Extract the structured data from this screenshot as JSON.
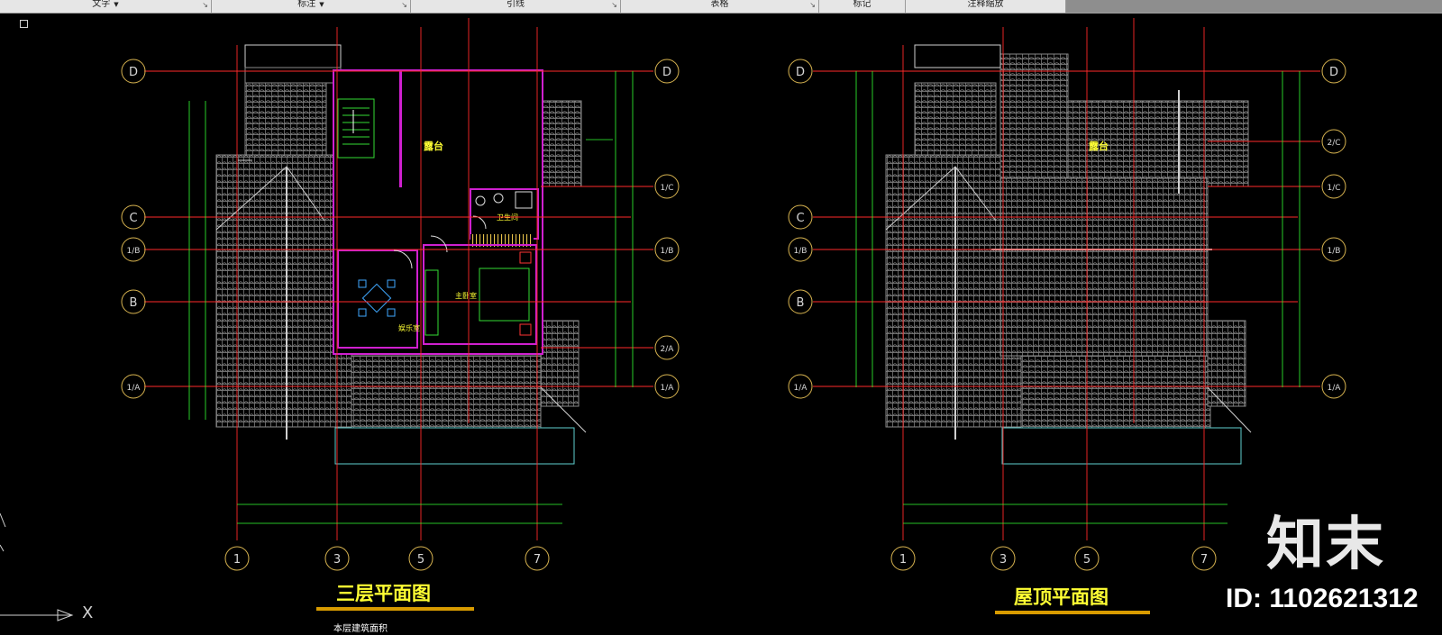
{
  "ribbon": {
    "panels": [
      {
        "label": "文字",
        "dropdown": true
      },
      {
        "label": "标注",
        "dropdown": true
      },
      {
        "label": "引线",
        "dropdown": false
      },
      {
        "label": "表格",
        "dropdown": false
      },
      {
        "label": "标记",
        "dropdown": false
      },
      {
        "label": "注释缩放",
        "dropdown": false
      }
    ]
  },
  "drawing": {
    "left_plan": {
      "title": "三层平面图",
      "note": "本层建筑面积",
      "room_labels": {
        "terrace": "露台",
        "bathroom": "卫生间",
        "master_bedroom": "主卧室",
        "entertainment": "娱乐室"
      },
      "grid_left": [
        "D",
        "C",
        "1/B",
        "B",
        "1/A"
      ],
      "grid_right": [
        "D",
        "1/C",
        "1/B",
        "2/A",
        "1/A"
      ],
      "grid_bottom": [
        "1",
        "3",
        "5",
        "7"
      ]
    },
    "right_plan": {
      "title": "屋顶平面图",
      "room_labels": {
        "terrace": "露台"
      },
      "grid_left": [
        "D",
        "C",
        "1/B",
        "B",
        "1/A"
      ],
      "grid_right": [
        "D",
        "2/C",
        "1/C",
        "1/B",
        "1/A"
      ],
      "grid_bottom": [
        "1",
        "3",
        "5",
        "7"
      ]
    }
  },
  "ucs": {
    "x_label": "X"
  },
  "watermark": {
    "logo": "知末",
    "id": "ID: 1102621312"
  },
  "colors": {
    "background": "#000000",
    "grid_axis_red": "#ff2a2a",
    "grid_axis_green": "#33ff33",
    "bubble_gold": "#d8b450",
    "roof_gray": "#8a8a8a",
    "wall_magenta": "#d020d0",
    "title_yellow": "#ffff33",
    "title_underline": "#d89b00"
  }
}
